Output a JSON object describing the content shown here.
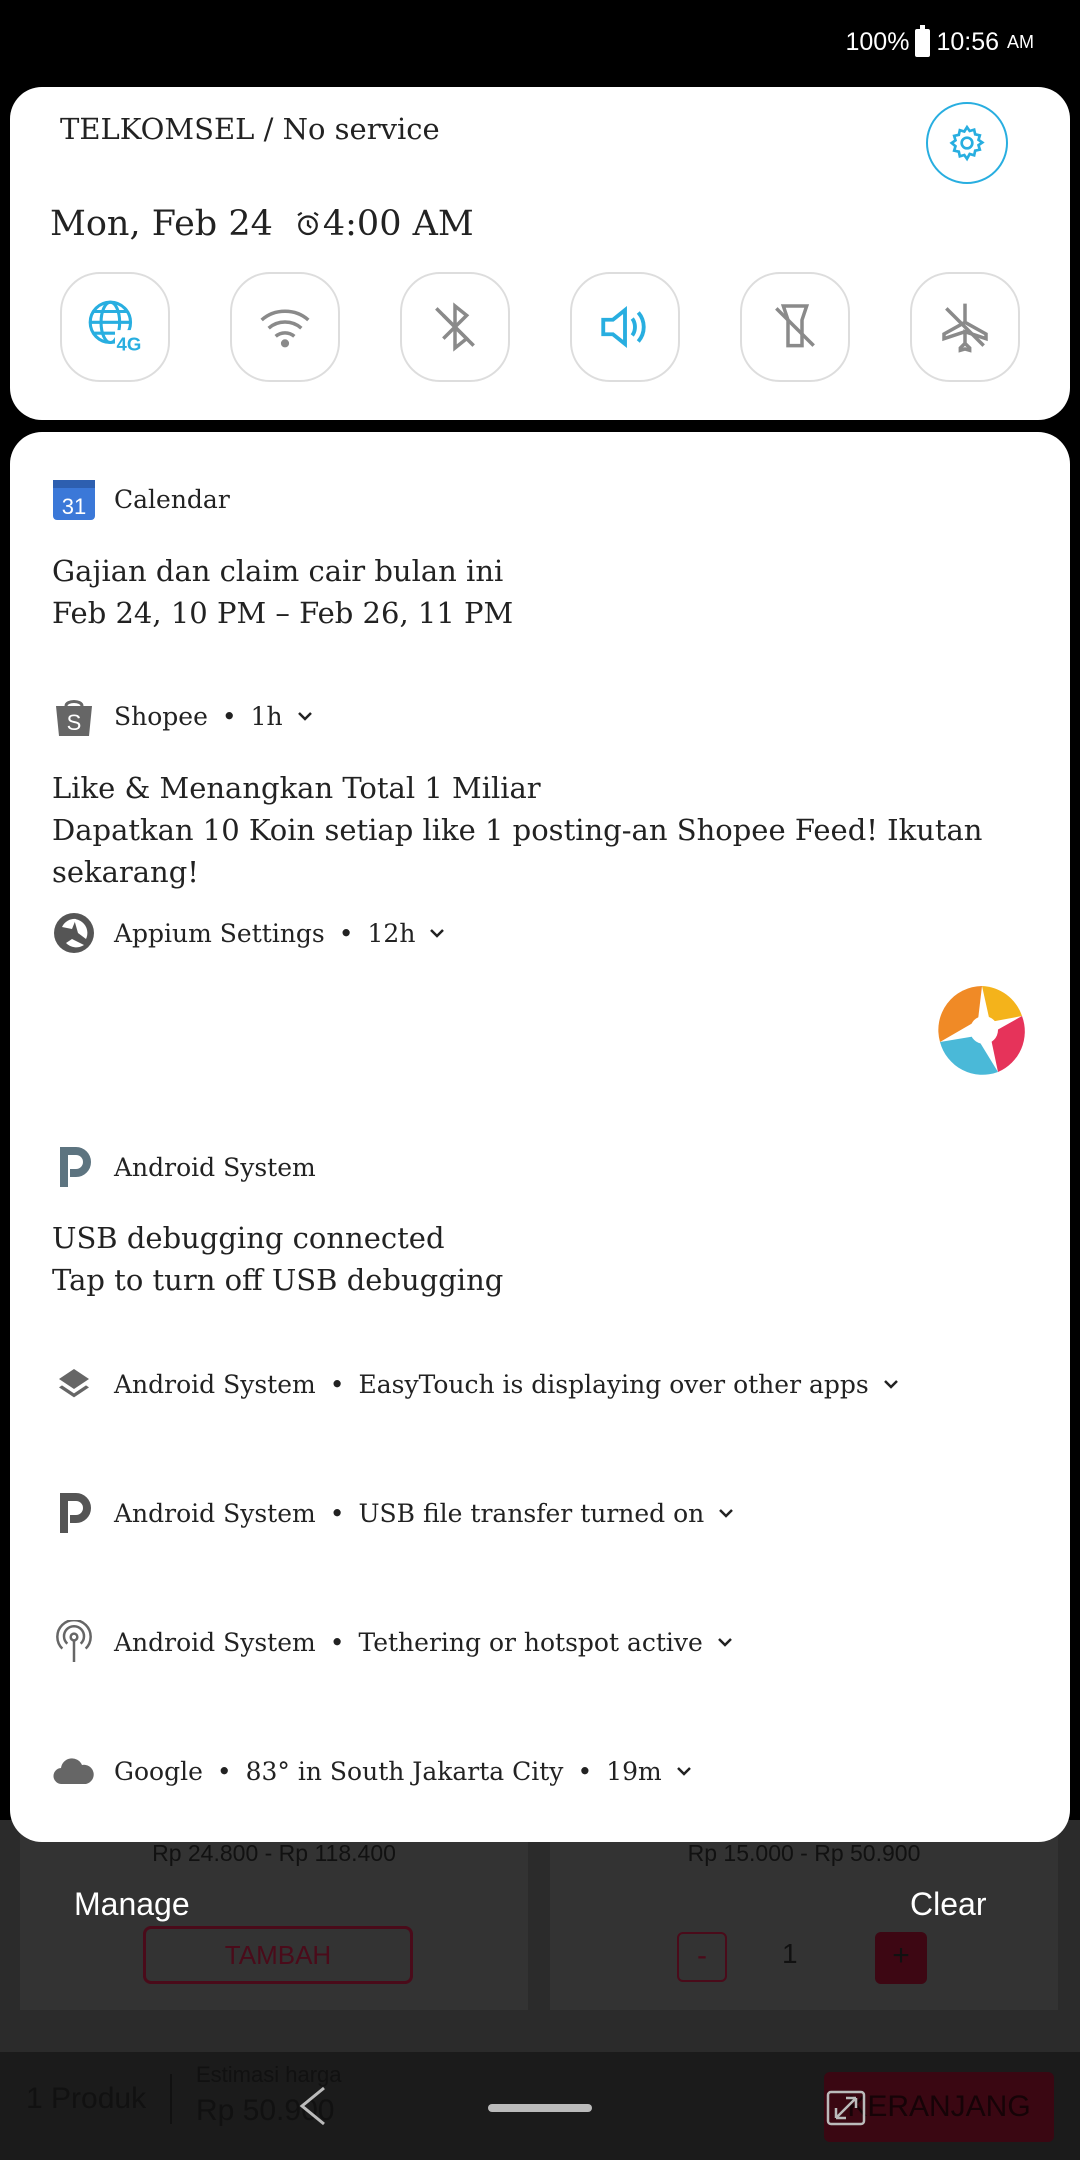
{
  "status_bar": {
    "battery": "100%",
    "time": "10:56",
    "ampm": "AM"
  },
  "quick_settings": {
    "carrier": "TELKOMSEL / No service",
    "date": "Mon, Feb 24",
    "alarm": "4:00 AM",
    "tiles": [
      {
        "name": "mobile-data-4g",
        "label": "4G",
        "active": true
      },
      {
        "name": "wifi",
        "active": false
      },
      {
        "name": "bluetooth-off",
        "active": false
      },
      {
        "name": "sound",
        "active": true
      },
      {
        "name": "flashlight-off",
        "active": false
      },
      {
        "name": "airplane-off",
        "active": false
      }
    ]
  },
  "notifications": {
    "calendar": {
      "app": "Calendar",
      "icon_number": "31",
      "title": "Gajian dan claim cair bulan ini",
      "text": "Feb 24, 10 PM – Feb 26, 11 PM"
    },
    "shopee": {
      "app": "Shopee",
      "time": "1h",
      "icon_letter": "S",
      "title": "Like & Menangkan Total 1 Miliar",
      "text": "Dapatkan 10 Koin setiap like 1 posting-an Shopee Feed! Ikutan sekarang!"
    },
    "appium": {
      "app": "Appium Settings",
      "time": "12h"
    },
    "usb_debugging": {
      "app": "Android System",
      "title": "USB debugging connected",
      "text": "Tap to turn off USB debugging"
    },
    "easytouch": {
      "app": "Android System",
      "text": "EasyTouch is displaying over other apps"
    },
    "usb_transfer": {
      "app": "Android System",
      "text": "USB file transfer turned on"
    },
    "tethering": {
      "app": "Android System",
      "text": "Tethering or hotspot active"
    },
    "google": {
      "app": "Google",
      "text": "83° in South Jakarta City",
      "time": "19m"
    }
  },
  "shade_actions": {
    "manage": "Manage",
    "clear": "Clear"
  },
  "background_app": {
    "price_left": "Rp 24.800 - Rp 118.400",
    "price_right": "Rp 15.000 - Rp 50.900",
    "add_button": "TAMBAH",
    "qty_minus": "-",
    "qty_value": "1",
    "qty_plus": "+",
    "product_count": "1 Produk",
    "estimate_label": "Estimasi harga",
    "estimate_value": "Rp 50.900",
    "cart_button": "KERANJANG"
  },
  "colors": {
    "accent": "#28aee0",
    "icon_gray": "#8a8a8a",
    "brand_maroon": "#8b1030"
  }
}
